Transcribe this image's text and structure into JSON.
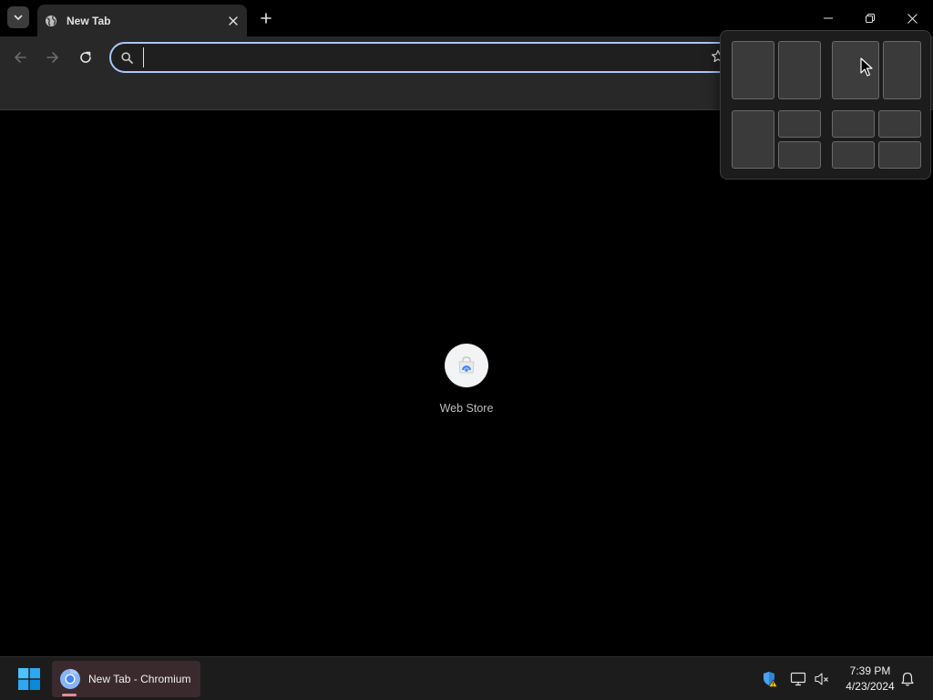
{
  "browser": {
    "tab": {
      "title": "New Tab"
    },
    "omnibox": {
      "value": "",
      "placeholder": ""
    },
    "window_controls": [
      "minimize",
      "restore",
      "close"
    ]
  },
  "content": {
    "shortcuts": [
      {
        "label": "Web Store",
        "icon": "web-store-icon"
      }
    ]
  },
  "snap_layouts": {
    "layouts": [
      {
        "name": "two-equal-columns",
        "zones": 2
      },
      {
        "name": "wide-narrow-columns",
        "zones": 2,
        "hovered_zone": 1
      },
      {
        "name": "column-and-two-stacked",
        "zones": 3
      },
      {
        "name": "four-quadrants",
        "zones": 4
      }
    ]
  },
  "taskbar": {
    "running_app": {
      "label": "New Tab - Chromium",
      "icon": "chromium-icon"
    },
    "tray_icons": [
      "security-warning-icon",
      "display-icon",
      "volume-muted-icon",
      "notification-bell-icon"
    ],
    "clock": {
      "time": "7:39 PM",
      "date": "4/23/2024"
    }
  },
  "colors": {
    "omnibox_focus": "#a8c7fa",
    "toolbar_bg": "#282828",
    "taskbar_indicator": "#e38d9a",
    "windows_blue": "#0078d4"
  }
}
